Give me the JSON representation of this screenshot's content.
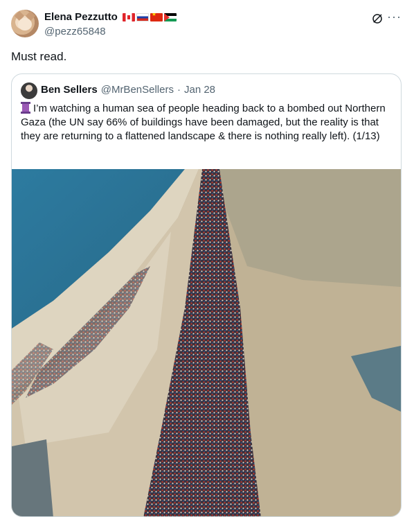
{
  "post": {
    "display_name": "Elena Pezzutto",
    "handle": "@pezz65848",
    "flags": [
      "ca-flag-icon",
      "ru-flag-icon",
      "cn-flag-icon",
      "ps-flag-icon"
    ],
    "text": "Must read."
  },
  "quoted": {
    "display_name": "Ben Sellers",
    "handle": "@MrBenSellers",
    "separator": "·",
    "date": "Jan 28",
    "text": "I’m watching a human sea of people heading back to a bombed out Northern Gaza (the UN say 66% of buildings have been damaged, but the reality is that they are returning to a flattened landscape & there is nothing really left). (1/13)"
  },
  "colors": {
    "text_primary": "#0f1419",
    "text_secondary": "#536471",
    "border": "#cfd9de"
  }
}
